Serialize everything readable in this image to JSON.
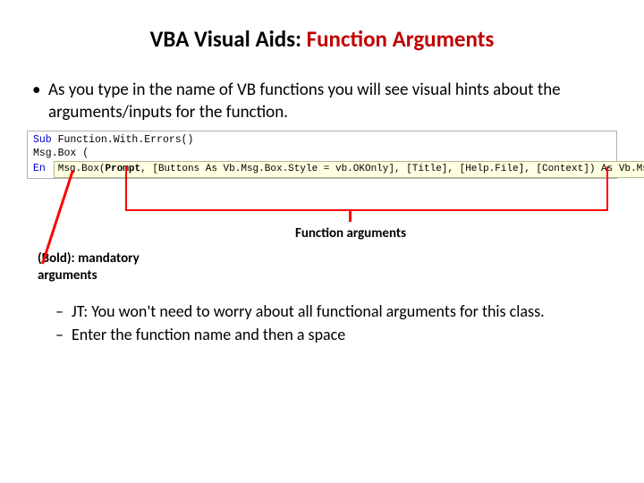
{
  "title": {
    "plain": "VBA Visual Aids: ",
    "emph": "Function Arguments"
  },
  "intro_bullet": "As you type in the name of VB functions you will see visual hints about the arguments/inputs for the function.",
  "code": {
    "line1_kw": "Sub",
    "line1_rest": " Function.With.Errors()",
    "line2": "    Msg.Box (",
    "line3_kw": "En",
    "tooltip": {
      "fn": "Msg.Box(",
      "bold_arg": "Prompt",
      "rest": ", [Buttons As Vb.Msg.Box.Style = vb.OKOnly], [Title], [Help.File], [Context]) As Vb.Msg.Box.Result"
    }
  },
  "labels": {
    "function_arguments": "Function arguments",
    "bold_mandatory_1": "(Bold): mandatory",
    "bold_mandatory_2": "arguments"
  },
  "sub_bullets": [
    "JT: You won't need to worry about all functional arguments for this class.",
    "Enter the function name and then a space"
  ]
}
